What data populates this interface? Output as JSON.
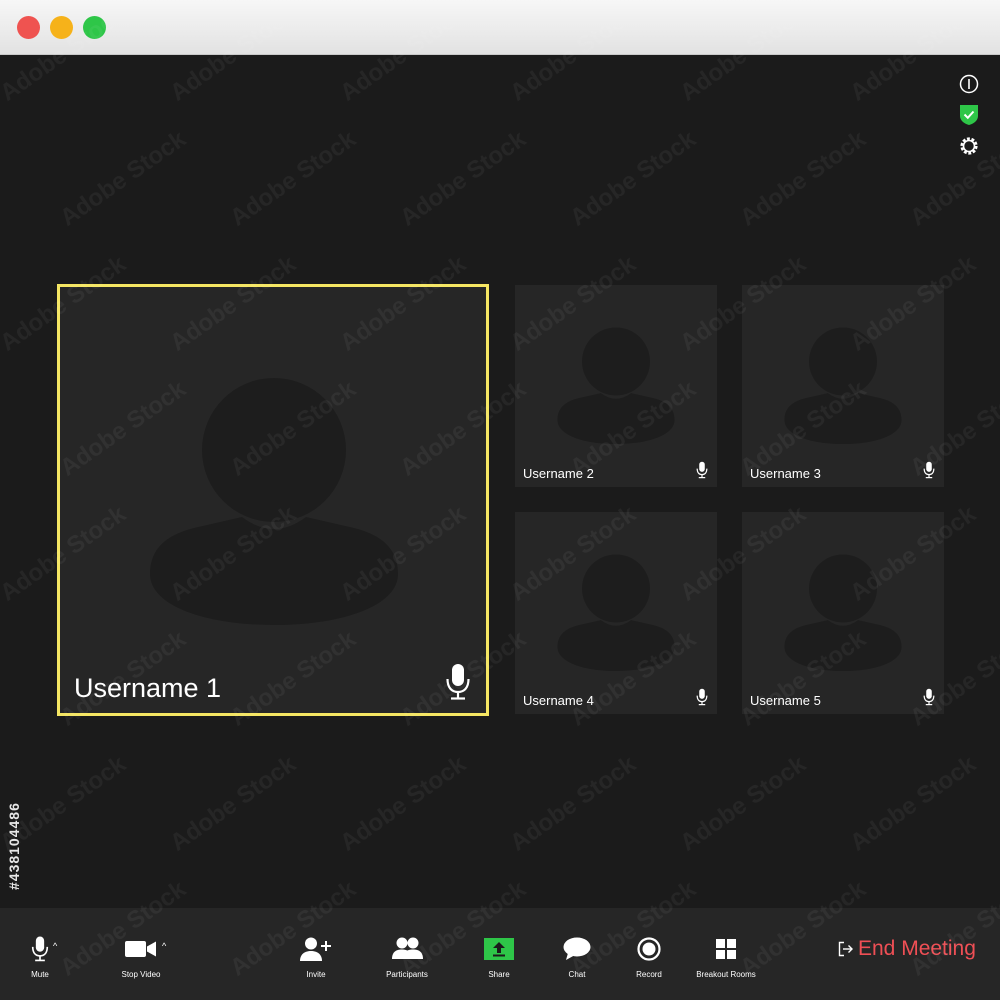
{
  "window": {
    "controls": [
      {
        "name": "close",
        "color": "#ef5350"
      },
      {
        "name": "minimize",
        "color": "#f6b21a"
      },
      {
        "name": "maximize",
        "color": "#2ec648"
      }
    ]
  },
  "top_icons": [
    "info-icon",
    "security-shield-icon",
    "settings-gear-icon"
  ],
  "participants": [
    {
      "name": "Username 1",
      "active_speaker": true,
      "mic": "microphone-icon"
    },
    {
      "name": "Username 2",
      "active_speaker": false,
      "mic": "microphone-icon"
    },
    {
      "name": "Username 3",
      "active_speaker": false,
      "mic": "microphone-icon"
    },
    {
      "name": "Username 4",
      "active_speaker": false,
      "mic": "microphone-icon"
    },
    {
      "name": "Username 5",
      "active_speaker": false,
      "mic": "microphone-icon"
    }
  ],
  "toolbar": {
    "mute": "Mute",
    "stop_video": "Stop Video",
    "invite": "Invite",
    "participants": "Participants",
    "share": "Share",
    "chat": "Chat",
    "record": "Record",
    "breakout_rooms": "Breakout Rooms",
    "end_meeting": "End Meeting"
  },
  "colors": {
    "active_speaker_border": "#f5e663",
    "share_green": "#2ec648",
    "end_meeting_red": "#ef4f55",
    "shield_green": "#2ec648"
  },
  "watermark": {
    "text": "Adobe Stock",
    "id": "#438104486"
  }
}
